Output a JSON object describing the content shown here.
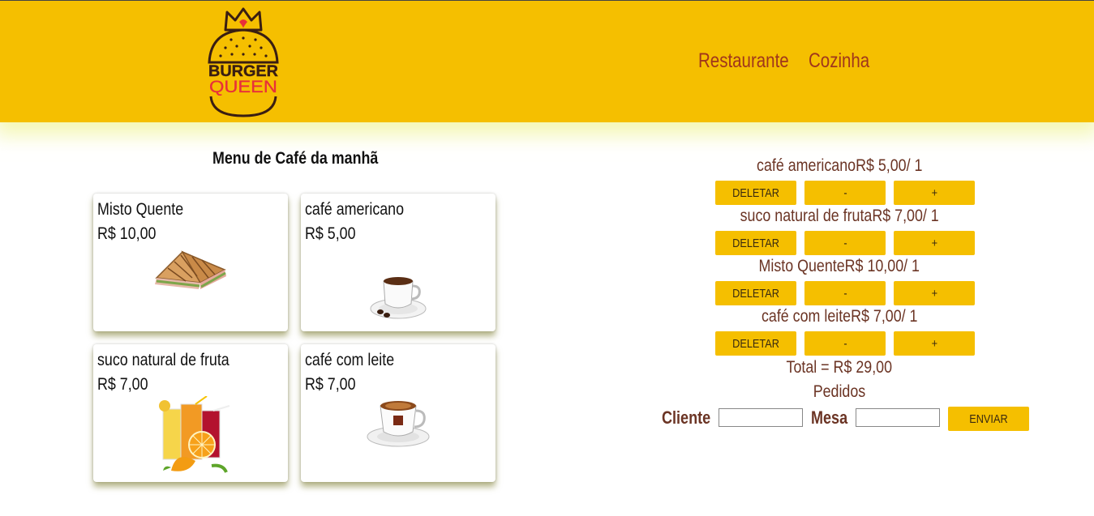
{
  "header": {
    "logo": {
      "line1": "BURGER",
      "line2": "QUEEN"
    },
    "nav": [
      {
        "label": "Restaurante"
      },
      {
        "label": "Cozinha"
      }
    ]
  },
  "menu": {
    "title": "Menu de Café da manhã",
    "items": [
      {
        "name": "Misto Quente",
        "price": "R$ 10,00",
        "icon": "sandwich-icon"
      },
      {
        "name": "café americano",
        "price": "R$ 5,00",
        "icon": "espresso-cup-icon"
      },
      {
        "name": "suco natural de fruta",
        "price": "R$ 7,00",
        "icon": "juice-glasses-icon"
      },
      {
        "name": "café com leite",
        "price": "R$ 7,00",
        "icon": "coffee-cup-icon"
      }
    ]
  },
  "order": {
    "items": [
      {
        "text": "café americanoR$ 5,00/ 1"
      },
      {
        "text": "suco natural de frutaR$ 7,00/ 1"
      },
      {
        "text": "Misto QuenteR$ 10,00/ 1"
      },
      {
        "text": "café com leiteR$ 7,00/ 1"
      }
    ],
    "delete_label": "DELETAR",
    "minus_label": "-",
    "plus_label": "+",
    "total": "Total = R$ 29,00",
    "orders_label": "Pedidos",
    "client_label": "Cliente",
    "table_label": "Mesa",
    "client_value": "",
    "table_value": "",
    "send_label": "ENVIAR"
  },
  "colors": {
    "header_bg": "#f5bf00",
    "accent_text": "#a0361c",
    "order_text": "#6b3424",
    "button_bg": "#f5bf00"
  }
}
